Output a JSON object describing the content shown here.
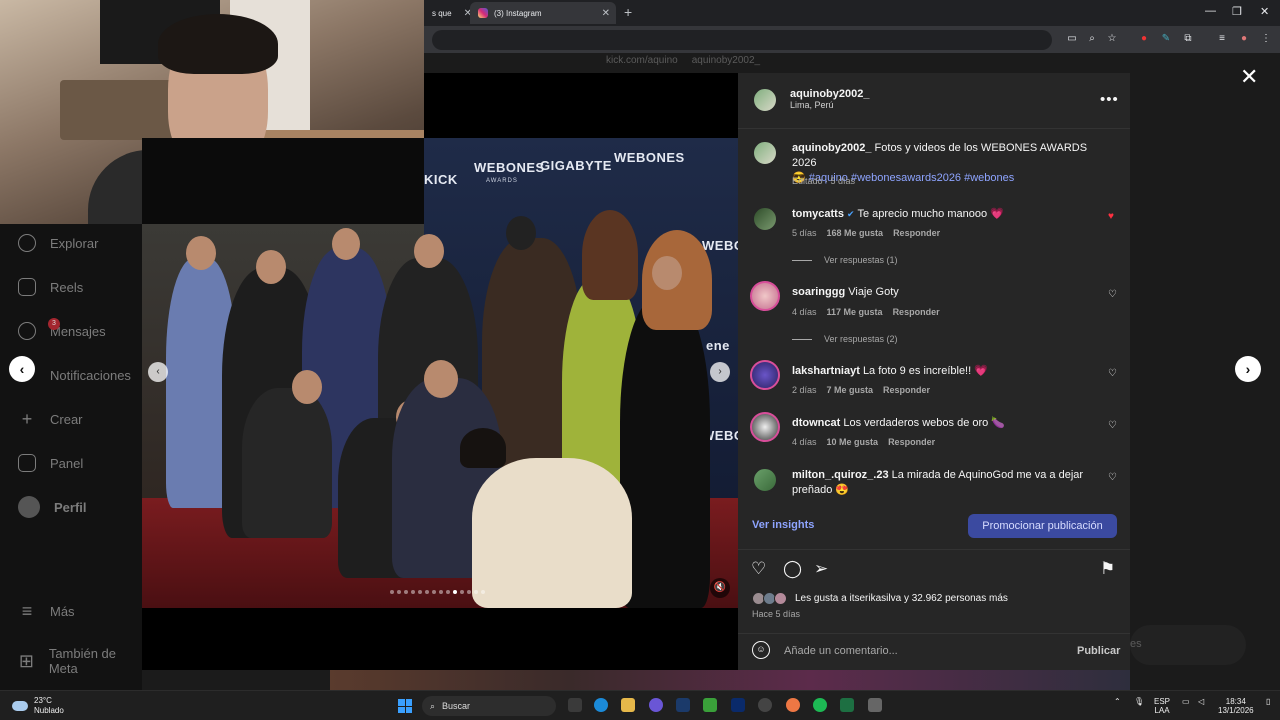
{
  "browser": {
    "prev_tab_title": "s que",
    "active_tab_title": "(3) Instagram",
    "new_tab": "+",
    "close": "✕",
    "win_min": "—",
    "win_max": "❐",
    "win_close": "✕"
  },
  "stream_links": {
    "kick": "kick.com/aquino",
    "ig": "aquinoby2002_"
  },
  "sidebar": {
    "items": [
      {
        "label": "Explorar",
        "icon": "compass-icon"
      },
      {
        "label": "Reels",
        "icon": "reels-icon"
      },
      {
        "label": "Mensajes",
        "icon": "messenger-icon",
        "badge": "3"
      },
      {
        "label": "Notificaciones",
        "icon": "heart-icon"
      },
      {
        "label": "Crear",
        "icon": "plus-icon"
      },
      {
        "label": "Panel",
        "icon": "chart-icon"
      },
      {
        "label": "Perfil",
        "icon": "avatar"
      },
      {
        "label": "Más",
        "icon": "menu-icon"
      },
      {
        "label": "También de Meta",
        "icon": "grid-icon"
      }
    ]
  },
  "photo": {
    "logos": {
      "kick": "KICK",
      "webones": "WEBONES",
      "awards": "AWARDS",
      "gigabyte": "GIGABYTE",
      "webones_vertical": "WEBONES",
      "enel": "ene"
    },
    "dots_total": 14,
    "dots_active": 10
  },
  "post": {
    "username": "aquinoby2002_",
    "location": "Lima, Perú",
    "caption_user": "aquinoby2002_",
    "caption_text": "Fotos y videos de los WEBONES AWARDS 2026",
    "caption_emoji": "😎",
    "hashtags": "#aquino #webonesawards2026 #webones",
    "caption_meta": "Editado · 5 días",
    "comments": [
      {
        "user": "tomycatts",
        "verified": "✔",
        "text": "Te aprecio mucho manooo 💗",
        "age": "5 días",
        "likes": "168 Me gusta",
        "reply": "Responder",
        "replies": "Ver respuestas (1)",
        "liked": true
      },
      {
        "user": "soaringgg",
        "text": "Viaje Goty",
        "age": "4 días",
        "likes": "117 Me gusta",
        "reply": "Responder",
        "replies": "Ver respuestas (2)",
        "liked": false
      },
      {
        "user": "lakshartniayt",
        "text": "La foto 9 es increíble!! 💗",
        "age": "2 días",
        "likes": "7 Me gusta",
        "reply": "Responder",
        "liked": false
      },
      {
        "user": "dtowncat",
        "text": "Los verdaderos webos de oro 🍆",
        "age": "4 días",
        "likes": "10 Me gusta",
        "reply": "Responder",
        "liked": false
      },
      {
        "user": "milton_.quiroz_.23",
        "text": "La mirada de AquinoGod me va a dejar preñado 😍",
        "liked": false
      }
    ],
    "insights": "Ver insights",
    "promote": "Promocionar publicación",
    "likes_text": "Les gusta a itserikasilva y 32.962 personas más",
    "time": "Hace 5 días",
    "comment_placeholder": "Añade un comentario...",
    "publish": "Publicar"
  },
  "background_right_text": "es",
  "taskbar": {
    "temp": "23°C",
    "weather": "Nublado",
    "search": "Buscar",
    "lang1": "ESP",
    "lang2": "LAA",
    "clock": "18:34",
    "date": "13/1/2026"
  }
}
